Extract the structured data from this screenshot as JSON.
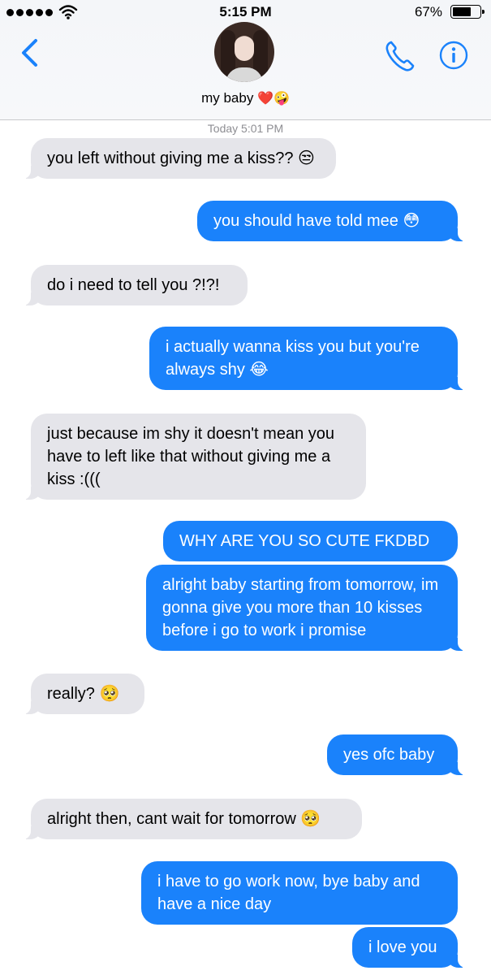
{
  "status_bar": {
    "time": "5:15 PM",
    "battery_percent": "67%",
    "battery_level": 0.67,
    "signal_bars": 5,
    "icons": [
      "signal-dots-icon",
      "wifi-icon",
      "battery-icon"
    ]
  },
  "header": {
    "contact_name": "my baby",
    "contact_emoji": "❤️🤪",
    "icons": [
      "back-chevron-icon",
      "phone-icon",
      "info-icon"
    ],
    "accent_color": "#1a82fb"
  },
  "conversation": {
    "timestamp": "Today 5:01 PM",
    "messages": [
      {
        "from": "them",
        "text": "you left without giving me a kiss?? 😒"
      },
      {
        "from": "me",
        "text": "you should have told mee 😳"
      },
      {
        "from": "them",
        "text": "do i need to tell you ?!?!"
      },
      {
        "from": "me",
        "text": "i actually wanna kiss you but you're always shy 😂"
      },
      {
        "from": "them",
        "text": "just because im shy it doesn't mean you have to left like that without giving me a kiss :((("
      },
      {
        "from": "me",
        "text": "WHY ARE YOU SO CUTE FKDBD"
      },
      {
        "from": "me",
        "text": "alright baby starting from tomorrow, im gonna give you more than 10 kisses before i go to work i promise"
      },
      {
        "from": "them",
        "text": "really? 🥺"
      },
      {
        "from": "me",
        "text": "yes ofc baby"
      },
      {
        "from": "them",
        "text": "alright then, cant wait for tomorrow 🥺"
      },
      {
        "from": "me",
        "text": "i have to go work now, bye baby and have a nice day"
      },
      {
        "from": "me",
        "text": "i love you"
      }
    ]
  },
  "colors": {
    "incoming_bubble": "#e5e5ea",
    "outgoing_bubble": "#1a82fb",
    "timestamp_text": "#8e8e93"
  }
}
